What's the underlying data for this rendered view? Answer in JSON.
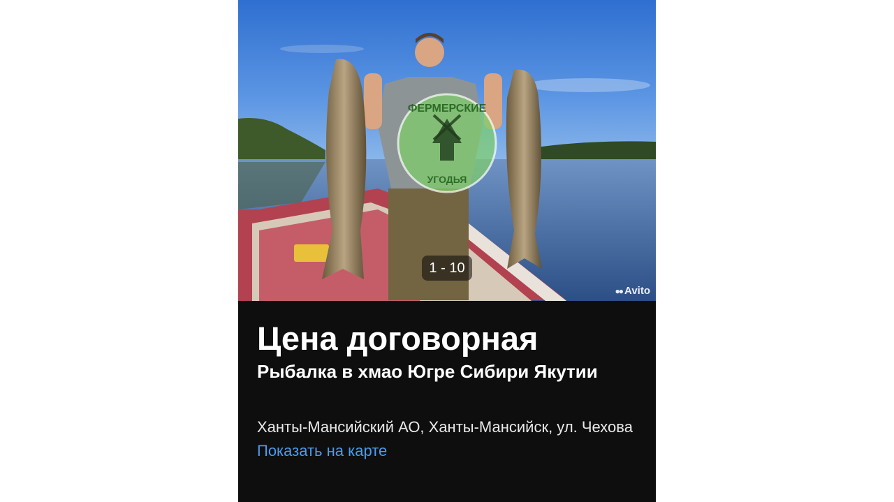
{
  "listing": {
    "photo_counter": "1 - 10",
    "photo_watermark": "Avito",
    "stamp_text_top": "ФЕРМЕРСКИЕ",
    "stamp_text_bottom": "УГОДЬЯ",
    "price": "Цена договорная",
    "title": "Рыбалка в хмао Югре Сибири Якутии",
    "address": "Ханты-Мансийский АО, Ханты-Мансийск, ул. Чехова",
    "map_link": "Показать на карте"
  },
  "colors": {
    "card_background": "#0e0e0e",
    "link": "#4a9cf0",
    "text": "#ffffff"
  }
}
